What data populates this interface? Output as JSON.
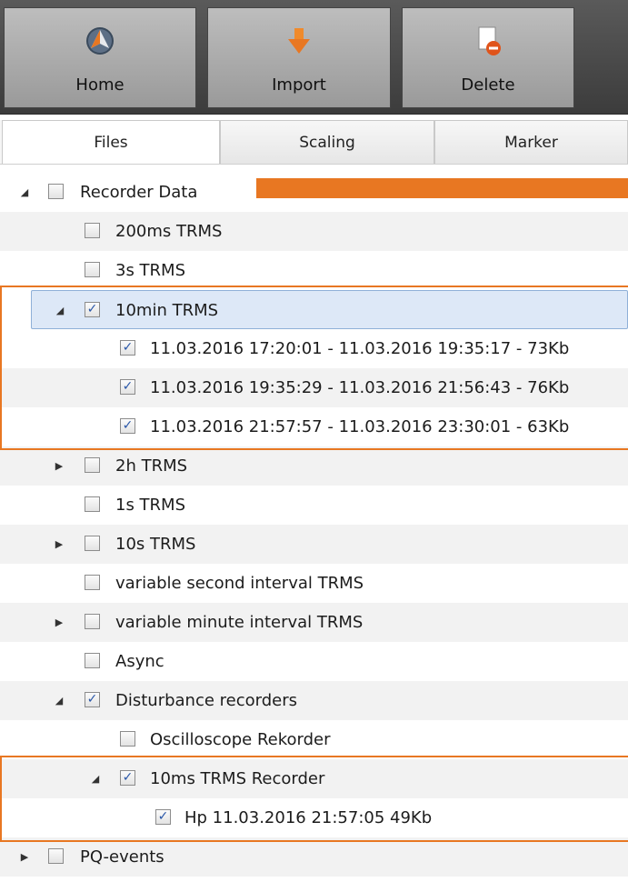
{
  "toolbar": {
    "home_label": "Home",
    "import_label": "Import",
    "delete_label": "Delete",
    "home_icon": "home-orb-icon",
    "import_icon": "import-arrow-icon",
    "delete_icon": "delete-document-icon"
  },
  "tabs": [
    {
      "label": "Files",
      "active": true
    },
    {
      "label": "Scaling",
      "active": false
    },
    {
      "label": "Marker",
      "active": false
    }
  ],
  "tree": {
    "recorder_data": "Recorder Data",
    "t200ms": "200ms TRMS",
    "t3s": "3s TRMS",
    "t10min": "10min TRMS",
    "f1": "11.03.2016 17:20:01 - 11.03.2016 19:35:17 - 73Kb",
    "f2": "11.03.2016 19:35:29 - 11.03.2016 21:56:43 - 76Kb",
    "f3": "11.03.2016 21:57:57 - 11.03.2016 23:30:01 - 63Kb",
    "t2h": "2h TRMS",
    "t1s": "1s TRMS",
    "t10s": "10s TRMS",
    "var_sec": "variable second interval TRMS",
    "var_min": "variable minute interval TRMS",
    "async": "Async",
    "dist": "Disturbance recorders",
    "osc": "Oscilloscope Rekorder",
    "t10ms": "10ms TRMS Recorder",
    "hp": "Hp 11.03.2016 21:57:05 49Kb",
    "pq": "PQ-events"
  },
  "colors": {
    "highlight": "#e87722",
    "selection": "#dde8f7",
    "check": "#2a57a8"
  }
}
